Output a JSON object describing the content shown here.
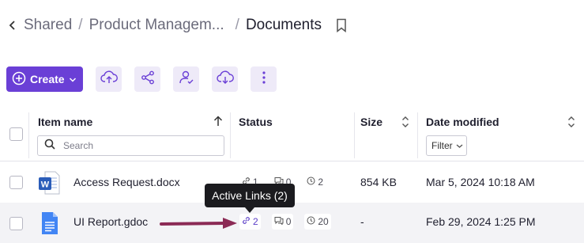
{
  "breadcrumb": {
    "items": [
      "Shared",
      "Product Managem...",
      "Documents"
    ],
    "separator": "/"
  },
  "toolbar": {
    "create_label": "Create",
    "buttons": [
      "upload-icon",
      "share-icon",
      "user-check-icon",
      "download-icon",
      "more-icon"
    ]
  },
  "table": {
    "columns": {
      "item_name": "Item name",
      "status": "Status",
      "size": "Size",
      "date_modified": "Date modified"
    },
    "search_placeholder": "Search",
    "filter_label": "Filter",
    "rows": [
      {
        "name": "Access Request.docx",
        "type": "word",
        "links": "1",
        "comments": "0",
        "versions": "2",
        "size": "854 KB",
        "date": "Mar 5, 2024 10:18 AM"
      },
      {
        "name": "UI Report.gdoc",
        "type": "gdoc",
        "links": "2",
        "comments": "0",
        "versions": "20",
        "size": "-",
        "date": "Feb 29, 2024 1:25 PM"
      }
    ]
  },
  "tooltip": {
    "text": "Active Links (2)"
  },
  "colors": {
    "accent": "#6a3fd6",
    "annotation_arrow": "#8b2a55",
    "word_blue": "#2b5db9",
    "gdoc_blue": "#4285f4"
  }
}
